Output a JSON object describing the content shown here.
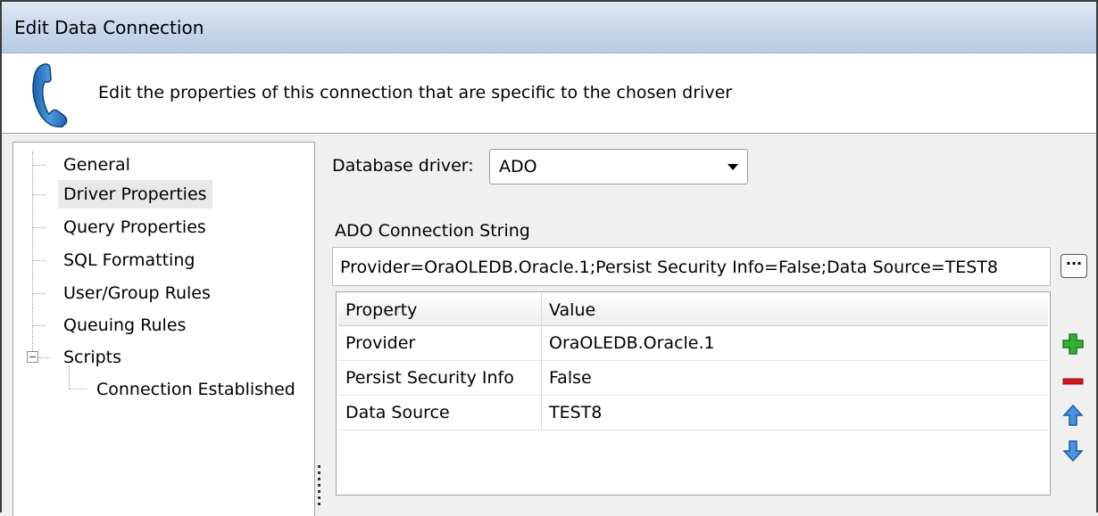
{
  "window": {
    "title": "Edit Data Connection"
  },
  "header": {
    "description": "Edit the properties of this connection that are specific to the chosen driver",
    "icon": "phone-icon"
  },
  "tree": {
    "items": [
      {
        "label": "General"
      },
      {
        "label": "Driver Properties",
        "selected": true
      },
      {
        "label": "Query Properties"
      },
      {
        "label": "SQL Formatting"
      },
      {
        "label": "User/Group Rules"
      },
      {
        "label": "Queuing Rules"
      },
      {
        "label": "Scripts",
        "expanded": true
      },
      {
        "label": "Connection Established",
        "child": true
      }
    ]
  },
  "driver": {
    "label": "Database driver:",
    "selected": "ADO"
  },
  "connection": {
    "label": "ADO Connection String",
    "value": "Provider=OraOLEDB.Oracle.1;Persist Security Info=False;Data Source=TEST8",
    "ellipsis_label": "···"
  },
  "grid": {
    "columns": [
      "Property",
      "Value"
    ],
    "rows": [
      [
        "Provider",
        "OraOLEDB.Oracle.1"
      ],
      [
        "Persist Security Info",
        "False"
      ],
      [
        "Data Source",
        "TEST8"
      ]
    ]
  },
  "side_buttons": [
    "add-icon",
    "remove-icon",
    "move-up-icon",
    "move-down-icon"
  ],
  "colors": {
    "titlebar": "#c7d6ea",
    "add": "#2fb12f",
    "remove": "#d11a1a",
    "arrow": "#3a86d9"
  }
}
